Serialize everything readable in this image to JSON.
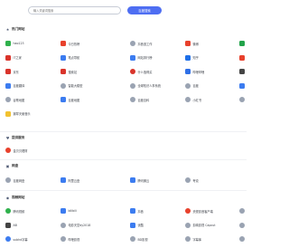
{
  "search": {
    "placeholder": "输入关键词搜索",
    "button_label": "百度搜索"
  },
  "sections": {
    "hot": {
      "title": "热门网站",
      "icon": "star-icon",
      "rows": [
        [
          {
            "label": "hao123",
            "color": "#2fb14c"
          },
          {
            "label": "今日热榜",
            "color": "#e8412c"
          },
          {
            "label": "抖音逛工作",
            "color": "#9aa3b2",
            "circle": true
          },
          {
            "label": "微博",
            "color": "#e8412c"
          },
          {
            "label": "",
            "color": "#22a34a"
          }
        ],
        [
          {
            "label": "IT之家",
            "color": "#d9342b"
          },
          {
            "label": "笔点导航",
            "color": "#3c7cf0"
          },
          {
            "label": "网站排行榜",
            "color": "#3c7cf0"
          },
          {
            "label": "知乎",
            "color": "#1e6fe8"
          },
          {
            "label": "",
            "color": "#e8412c"
          }
        ],
        [
          {
            "label": "京东",
            "color": "#d9342b"
          },
          {
            "label": "搜索站",
            "color": "#d9342b"
          },
          {
            "label": "什么值得买",
            "color": "#d9342b",
            "circle": true
          },
          {
            "label": "哔哩哔哩",
            "color": "#2f6fe6"
          },
          {
            "label": "",
            "color": "#444"
          }
        ],
        [
          {
            "label": "百度翻译",
            "color": "#3c7cf0"
          },
          {
            "label": "智能大模型",
            "color": "#9aa3b2",
            "circle": true
          },
          {
            "label": "全球知识人事系统",
            "color": "#9aa3b2",
            "circle": true
          },
          {
            "label": "百度",
            "color": "#9aa3b2",
            "circle": true
          },
          {
            "label": "",
            "color": "#3c7cf0"
          }
        ],
        [
          {
            "label": "谷歌地图",
            "color": "#9aa3b2",
            "circle": true
          },
          {
            "label": "百度地图",
            "color": "#3c7cf0"
          },
          {
            "label": "百度百科",
            "color": "#9aa3b2",
            "circle": true
          },
          {
            "label": "小红书",
            "color": "#9aa3b2",
            "circle": true
          },
          {
            "label": "",
            "color": "#9aa3b2",
            "circle": true
          }
        ],
        [
          {
            "label": "钢琴天使音乐",
            "color": "#f2c230"
          }
        ]
      ]
    },
    "services": {
      "title": "提供服务",
      "icon": "heart-icon",
      "items": [
        {
          "label": "金贝贝理财",
          "color": "#e8412c",
          "circle": true
        }
      ]
    },
    "netdisk": {
      "title": "网盘",
      "icon": "disk-icon",
      "items": [
        {
          "label": "百度网盘",
          "color": "#9aa3b2",
          "circle": true
        },
        {
          "label": "阿里云盘",
          "color": "#3c7cf0"
        },
        {
          "label": "腾讯微云",
          "color": "#3c7cf0"
        },
        {
          "label": "夸克",
          "color": "#9aa3b2",
          "circle": true
        }
      ]
    },
    "video": {
      "title": "视频网站",
      "icon": "play-icon",
      "rows": [
        [
          {
            "label": "腾讯视频",
            "color": "#2fb14c",
            "circle": true
          },
          {
            "label": "bilibili",
            "color": "#3c7cf0"
          },
          {
            "label": "抖音",
            "color": "#3c7cf0"
          },
          {
            "label": "央视影音客户端",
            "color": "#e8412c",
            "circle": true
          },
          {
            "label": "",
            "color": "#9aa3b2",
            "circle": true
          }
        ],
        [
          {
            "label": "AB",
            "color": "#444"
          },
          {
            "label": "电影天堂dy2018",
            "color": "#9aa3b2",
            "circle": true
          },
          {
            "label": "优酷",
            "color": "#3c7cf0"
          },
          {
            "label": "剪映影视 Capcut",
            "color": "#9aa3b2",
            "circle": true
          },
          {
            "label": "",
            "color": "#9aa3b2",
            "circle": true
          }
        ],
        [
          {
            "label": "subhd字幕",
            "color": "#3c7cf0",
            "circle": true
          },
          {
            "label": "哔哩影视",
            "color": "#9aa3b2",
            "circle": true
          },
          {
            "label": "BD影视",
            "color": "#9aa3b2",
            "circle": true
          },
          {
            "label": "字幕库",
            "color": "#9aa3b2",
            "circle": true
          },
          {
            "label": "",
            "color": "#9aa3b2",
            "circle": true
          }
        ]
      ]
    }
  }
}
